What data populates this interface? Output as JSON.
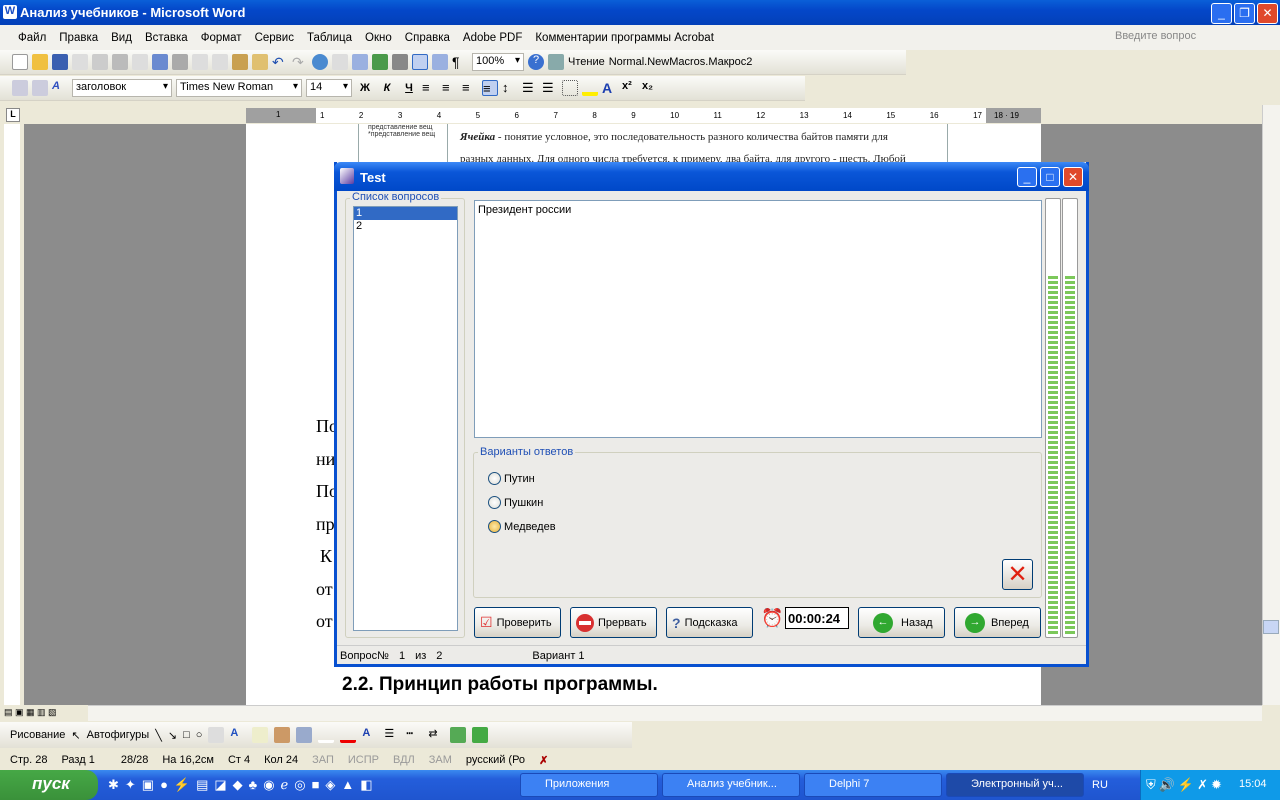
{
  "window": {
    "title": "Анализ учебников - Microsoft Word"
  },
  "menu": [
    "Файл",
    "Правка",
    "Вид",
    "Вставка",
    "Формат",
    "Сервис",
    "Таблица",
    "Окно",
    "Справка",
    "Adobe PDF",
    "Комментарии программы Acrobat"
  ],
  "help_placeholder": "Введите вопрос",
  "toolbar": {
    "zoom": "100%",
    "reading": "Чтение",
    "macro": "Normal.NewMacros.Макрос2",
    "style": "заголовок",
    "font": "Times New Roman",
    "size": "14",
    "bold": "Ж",
    "italic": "К",
    "underline": "Ч"
  },
  "ruler": [
    "1",
    "·",
    "1",
    "2",
    "3",
    "4",
    "5",
    "6",
    "7",
    "8",
    "9",
    "10",
    "11",
    "12",
    "13",
    "14",
    "15",
    "16",
    "17",
    "18",
    "19"
  ],
  "document": {
    "side_text": [
      "представление вещ",
      "*представление вещ"
    ],
    "para_lead": "Ячейка",
    "para_line1": " - понятие условное, это последовательность разного количества байтов памяти для",
    "para_line2": "разных данных. Для одного числа требуется, к примеру, два байта, для другого - шесть. Любой",
    "left_fragments": [
      "По",
      "ни",
      "По",
      "пр",
      "К",
      "от",
      "от"
    ],
    "heading": "2.2. Принцип работы программы."
  },
  "drawing": {
    "draw": "Рисование",
    "autoshapes": "Автофигуры"
  },
  "statusbar": {
    "page": "Стр. 28",
    "section": "Разд 1",
    "pages": "28/28",
    "at": "На 16,2см",
    "line": "Ст 4",
    "col": "Кол 24",
    "rec": "ЗАП",
    "trk": "ИСПР",
    "ext": "ВДЛ",
    "ovr": "ЗАМ",
    "lang": "русский (Ро"
  },
  "taskbar": {
    "start": "пуск",
    "tasks": [
      "Приложения",
      "Анализ учебник...",
      "Delphi 7",
      "Электронный уч..."
    ],
    "lang": "RU",
    "clock": "15:04"
  },
  "dialog": {
    "title": "Test",
    "questions_label": "Список вопросов",
    "questions": [
      "1",
      "2"
    ],
    "question_text": "Президент россии",
    "answers_label": "Варианты ответов",
    "answers": [
      "Путин",
      "Пушкин",
      "Медведев"
    ],
    "selected_answer": "Медведев",
    "buttons": {
      "check": "Проверить",
      "abort": "Прервать",
      "hint": "Подсказка",
      "back": "Назад",
      "forward": "Вперед"
    },
    "timer": "00:00:24",
    "progress_left": 0.82,
    "progress_right": 0.82,
    "status": {
      "q_label": "Вопрос№",
      "q_num": "1",
      "of": "из",
      "q_total": "2",
      "variant": "Вариант 1"
    }
  }
}
